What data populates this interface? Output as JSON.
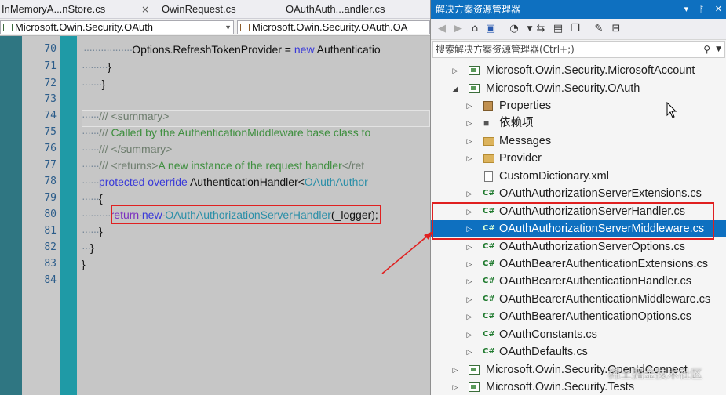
{
  "editor": {
    "tabs": [
      {
        "label": "InMemoryA...nStore.cs"
      },
      {
        "label": "OwinRequest.cs"
      },
      {
        "label": "OAuthAuth...andler.cs"
      }
    ],
    "tab_close_glyph": "×",
    "nav_left": "Microsoft.Owin.Security.OAuth",
    "nav_right": "Microsoft.Owin.Security.OAuth.OA",
    "line_numbers": [
      "70",
      "71",
      "72",
      "73",
      "74",
      "75",
      "76",
      "77",
      "78",
      "79",
      "80",
      "81",
      "82",
      "83",
      "84"
    ],
    "code": {
      "l70_a": "Options.RefreshTokenProvider = ",
      "l70_kw": "new",
      "l70_b": " Authenticatio",
      "l71": "}",
      "l72": "}",
      "l74_tag": "/// <summary>",
      "l75_prefix": "///",
      "l75_text": " Called by the AuthenticationMiddleware base class to",
      "l76_tag": "/// </summary>",
      "l77_tag": "/// <returns>",
      "l77_text": "A new instance of the request handler",
      "l77_end": "</ret",
      "l78_kw1": "protected",
      "l78_kw2": "override",
      "l78_type": "AuthenticationHandler<",
      "l78_generic": "OAuthAuthor",
      "l79": "{",
      "l80_kw1": "return",
      "l80_kw2": "new",
      "l80_type": "OAuthAuthorizationServerHandler",
      "l80_tail": "(_logger);",
      "l81": "}",
      "l82": "}",
      "l83": "}",
      "l84": "​"
    }
  },
  "solution_explorer": {
    "title": "解决方案资源管理器",
    "title_buttons": [
      "▾",
      "ᚠ",
      "✕"
    ],
    "search_placeholder": "搜索解决方案资源管理器(Ctrl+;)",
    "search_icon": "search-icon",
    "items": [
      {
        "label": "Microsoft.Owin.Security.MicrosoftAccount",
        "icon": "project-icon",
        "expander": "▷"
      },
      {
        "label": "Microsoft.Owin.Security.OAuth",
        "icon": "project-icon",
        "expander": "◢"
      },
      {
        "label": "Properties",
        "icon": "properties-icon",
        "expander": "▷"
      },
      {
        "label": "依赖项",
        "icon": "references-icon",
        "expander": "▷"
      },
      {
        "label": "Messages",
        "icon": "folder-icon",
        "expander": "▷"
      },
      {
        "label": "Provider",
        "icon": "folder-icon",
        "expander": "▷"
      },
      {
        "label": "CustomDictionary.xml",
        "icon": "xml-file-icon",
        "expander": ""
      },
      {
        "label": "OAuthAuthorizationServerExtensions.cs",
        "icon": "csharp-file-icon",
        "expander": "▷"
      },
      {
        "label": "OAuthAuthorizationServerHandler.cs",
        "icon": "csharp-file-icon",
        "expander": "▷"
      },
      {
        "label": "OAuthAuthorizationServerMiddleware.cs",
        "icon": "csharp-file-icon",
        "expander": "▷",
        "selected": true
      },
      {
        "label": "OAuthAuthorizationServerOptions.cs",
        "icon": "csharp-file-icon",
        "expander": "▷"
      },
      {
        "label": "OAuthBearerAuthenticationExtensions.cs",
        "icon": "csharp-file-icon",
        "expander": "▷"
      },
      {
        "label": "OAuthBearerAuthenticationHandler.cs",
        "icon": "csharp-file-icon",
        "expander": "▷"
      },
      {
        "label": "OAuthBearerAuthenticationMiddleware.cs",
        "icon": "csharp-file-icon",
        "expander": "▷"
      },
      {
        "label": "OAuthBearerAuthenticationOptions.cs",
        "icon": "csharp-file-icon",
        "expander": "▷"
      },
      {
        "label": "OAuthConstants.cs",
        "icon": "csharp-file-icon",
        "expander": "▷"
      },
      {
        "label": "OAuthDefaults.cs",
        "icon": "csharp-file-icon",
        "expander": "▷"
      },
      {
        "label": "Microsoft.Owin.Security.OpenIdConnect",
        "icon": "project-icon",
        "expander": "▷"
      },
      {
        "label": "Microsoft.Owin.Security.Tests",
        "icon": "project-icon",
        "expander": "▷"
      }
    ],
    "cs_glyph": "C#",
    "ref_glyph": "■",
    "watermark": "稀土掘金技术社区"
  },
  "colors": {
    "selection": "#0e70c0",
    "annotation_red": "#e02020",
    "gutter_teal": "#1f9aa6"
  }
}
